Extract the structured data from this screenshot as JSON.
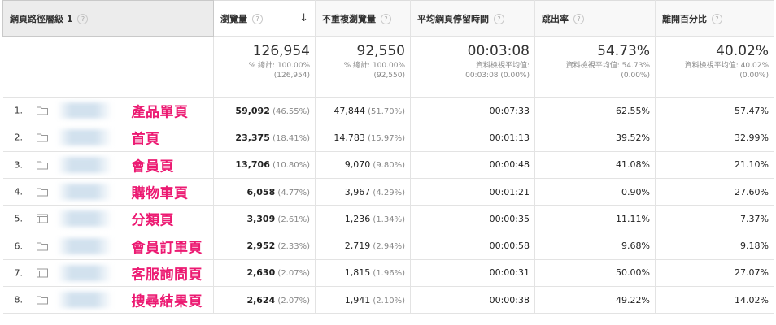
{
  "columns": {
    "dimension": "網頁路徑層級 1",
    "pageviews": "瀏覽量",
    "unique": "不重複瀏覽量",
    "avg_time": "平均網頁停留時間",
    "bounce": "跳出率",
    "exit": "離開百分比"
  },
  "totals": {
    "pageviews": {
      "value": "126,954",
      "line1": "% 總計: 100.00%",
      "line2": "(126,954)"
    },
    "unique": {
      "value": "92,550",
      "line1": "% 總計: 100.00%",
      "line2": "(92,550)"
    },
    "avg_time": {
      "value": "00:03:08",
      "line1": "資料檢視平均值:",
      "line2": "00:03:08 (0.00%)"
    },
    "bounce": {
      "value": "54.73%",
      "line1": "資料檢視平均值: 54.73%",
      "line2": "(0.00%)"
    },
    "exit": {
      "value": "40.02%",
      "line1": "資料檢視平均值: 40.02%",
      "line2": "(0.00%)"
    }
  },
  "rows": [
    {
      "index": "1.",
      "icon": "folder-icon",
      "name": "產品單頁",
      "pageviews": "59,092",
      "pv_pct": "(46.55%)",
      "unique": "47,844",
      "uv_pct": "(51.70%)",
      "avg_time": "00:07:33",
      "bounce": "62.55%",
      "exit": "57.47%"
    },
    {
      "index": "2.",
      "icon": "folder-icon",
      "name": "首頁",
      "pageviews": "23,375",
      "pv_pct": "(18.41%)",
      "unique": "14,783",
      "uv_pct": "(15.97%)",
      "avg_time": "00:01:13",
      "bounce": "39.52%",
      "exit": "32.99%"
    },
    {
      "index": "3.",
      "icon": "folder-icon",
      "name": "會員頁",
      "pageviews": "13,706",
      "pv_pct": "(10.80%)",
      "unique": "9,070",
      "uv_pct": "(9.80%)",
      "avg_time": "00:00:48",
      "bounce": "41.08%",
      "exit": "21.10%"
    },
    {
      "index": "4.",
      "icon": "folder-icon",
      "name": "購物車頁",
      "pageviews": "6,058",
      "pv_pct": "(4.77%)",
      "unique": "3,967",
      "uv_pct": "(4.29%)",
      "avg_time": "00:01:21",
      "bounce": "0.90%",
      "exit": "27.60%"
    },
    {
      "index": "5.",
      "icon": "page-icon",
      "name": "分類頁",
      "pageviews": "3,309",
      "pv_pct": "(2.61%)",
      "unique": "1,236",
      "uv_pct": "(1.34%)",
      "avg_time": "00:00:35",
      "bounce": "11.11%",
      "exit": "7.37%"
    },
    {
      "index": "6.",
      "icon": "folder-icon",
      "name": "會員訂單頁",
      "pageviews": "2,952",
      "pv_pct": "(2.33%)",
      "unique": "2,719",
      "uv_pct": "(2.94%)",
      "avg_time": "00:00:58",
      "bounce": "9.68%",
      "exit": "9.18%"
    },
    {
      "index": "7.",
      "icon": "page-icon",
      "name": "客服詢問頁",
      "pageviews": "2,630",
      "pv_pct": "(2.07%)",
      "unique": "1,815",
      "uv_pct": "(1.96%)",
      "avg_time": "00:00:31",
      "bounce": "50.00%",
      "exit": "27.07%"
    },
    {
      "index": "8.",
      "icon": "folder-icon",
      "name": "搜尋結果頁",
      "pageviews": "2,624",
      "pv_pct": "(2.07%)",
      "unique": "1,941",
      "uv_pct": "(2.10%)",
      "avg_time": "00:00:38",
      "bounce": "49.22%",
      "exit": "14.02%"
    }
  ],
  "colors": {
    "annotation": "#ec1a72",
    "header_bg": "#f8f8f8",
    "grid": "#e3e3e3"
  }
}
